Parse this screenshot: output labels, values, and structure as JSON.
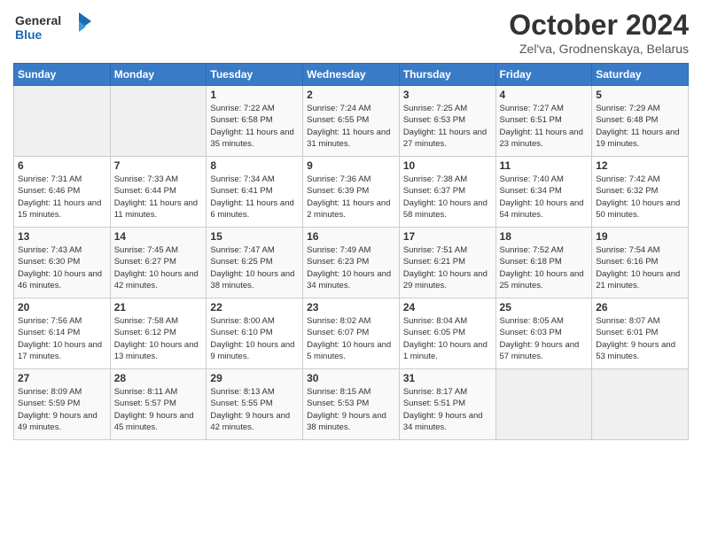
{
  "header": {
    "logo_line1": "General",
    "logo_line2": "Blue",
    "month_title": "October 2024",
    "location": "Zel'va, Grodnenskaya, Belarus"
  },
  "weekdays": [
    "Sunday",
    "Monday",
    "Tuesday",
    "Wednesday",
    "Thursday",
    "Friday",
    "Saturday"
  ],
  "weeks": [
    [
      {
        "day": "",
        "info": ""
      },
      {
        "day": "",
        "info": ""
      },
      {
        "day": "1",
        "info": "Sunrise: 7:22 AM\nSunset: 6:58 PM\nDaylight: 11 hours and 35 minutes."
      },
      {
        "day": "2",
        "info": "Sunrise: 7:24 AM\nSunset: 6:55 PM\nDaylight: 11 hours and 31 minutes."
      },
      {
        "day": "3",
        "info": "Sunrise: 7:25 AM\nSunset: 6:53 PM\nDaylight: 11 hours and 27 minutes."
      },
      {
        "day": "4",
        "info": "Sunrise: 7:27 AM\nSunset: 6:51 PM\nDaylight: 11 hours and 23 minutes."
      },
      {
        "day": "5",
        "info": "Sunrise: 7:29 AM\nSunset: 6:48 PM\nDaylight: 11 hours and 19 minutes."
      }
    ],
    [
      {
        "day": "6",
        "info": "Sunrise: 7:31 AM\nSunset: 6:46 PM\nDaylight: 11 hours and 15 minutes."
      },
      {
        "day": "7",
        "info": "Sunrise: 7:33 AM\nSunset: 6:44 PM\nDaylight: 11 hours and 11 minutes."
      },
      {
        "day": "8",
        "info": "Sunrise: 7:34 AM\nSunset: 6:41 PM\nDaylight: 11 hours and 6 minutes."
      },
      {
        "day": "9",
        "info": "Sunrise: 7:36 AM\nSunset: 6:39 PM\nDaylight: 11 hours and 2 minutes."
      },
      {
        "day": "10",
        "info": "Sunrise: 7:38 AM\nSunset: 6:37 PM\nDaylight: 10 hours and 58 minutes."
      },
      {
        "day": "11",
        "info": "Sunrise: 7:40 AM\nSunset: 6:34 PM\nDaylight: 10 hours and 54 minutes."
      },
      {
        "day": "12",
        "info": "Sunrise: 7:42 AM\nSunset: 6:32 PM\nDaylight: 10 hours and 50 minutes."
      }
    ],
    [
      {
        "day": "13",
        "info": "Sunrise: 7:43 AM\nSunset: 6:30 PM\nDaylight: 10 hours and 46 minutes."
      },
      {
        "day": "14",
        "info": "Sunrise: 7:45 AM\nSunset: 6:27 PM\nDaylight: 10 hours and 42 minutes."
      },
      {
        "day": "15",
        "info": "Sunrise: 7:47 AM\nSunset: 6:25 PM\nDaylight: 10 hours and 38 minutes."
      },
      {
        "day": "16",
        "info": "Sunrise: 7:49 AM\nSunset: 6:23 PM\nDaylight: 10 hours and 34 minutes."
      },
      {
        "day": "17",
        "info": "Sunrise: 7:51 AM\nSunset: 6:21 PM\nDaylight: 10 hours and 29 minutes."
      },
      {
        "day": "18",
        "info": "Sunrise: 7:52 AM\nSunset: 6:18 PM\nDaylight: 10 hours and 25 minutes."
      },
      {
        "day": "19",
        "info": "Sunrise: 7:54 AM\nSunset: 6:16 PM\nDaylight: 10 hours and 21 minutes."
      }
    ],
    [
      {
        "day": "20",
        "info": "Sunrise: 7:56 AM\nSunset: 6:14 PM\nDaylight: 10 hours and 17 minutes."
      },
      {
        "day": "21",
        "info": "Sunrise: 7:58 AM\nSunset: 6:12 PM\nDaylight: 10 hours and 13 minutes."
      },
      {
        "day": "22",
        "info": "Sunrise: 8:00 AM\nSunset: 6:10 PM\nDaylight: 10 hours and 9 minutes."
      },
      {
        "day": "23",
        "info": "Sunrise: 8:02 AM\nSunset: 6:07 PM\nDaylight: 10 hours and 5 minutes."
      },
      {
        "day": "24",
        "info": "Sunrise: 8:04 AM\nSunset: 6:05 PM\nDaylight: 10 hours and 1 minute."
      },
      {
        "day": "25",
        "info": "Sunrise: 8:05 AM\nSunset: 6:03 PM\nDaylight: 9 hours and 57 minutes."
      },
      {
        "day": "26",
        "info": "Sunrise: 8:07 AM\nSunset: 6:01 PM\nDaylight: 9 hours and 53 minutes."
      }
    ],
    [
      {
        "day": "27",
        "info": "Sunrise: 8:09 AM\nSunset: 5:59 PM\nDaylight: 9 hours and 49 minutes."
      },
      {
        "day": "28",
        "info": "Sunrise: 8:11 AM\nSunset: 5:57 PM\nDaylight: 9 hours and 45 minutes."
      },
      {
        "day": "29",
        "info": "Sunrise: 8:13 AM\nSunset: 5:55 PM\nDaylight: 9 hours and 42 minutes."
      },
      {
        "day": "30",
        "info": "Sunrise: 8:15 AM\nSunset: 5:53 PM\nDaylight: 9 hours and 38 minutes."
      },
      {
        "day": "31",
        "info": "Sunrise: 8:17 AM\nSunset: 5:51 PM\nDaylight: 9 hours and 34 minutes."
      },
      {
        "day": "",
        "info": ""
      },
      {
        "day": "",
        "info": ""
      }
    ]
  ]
}
